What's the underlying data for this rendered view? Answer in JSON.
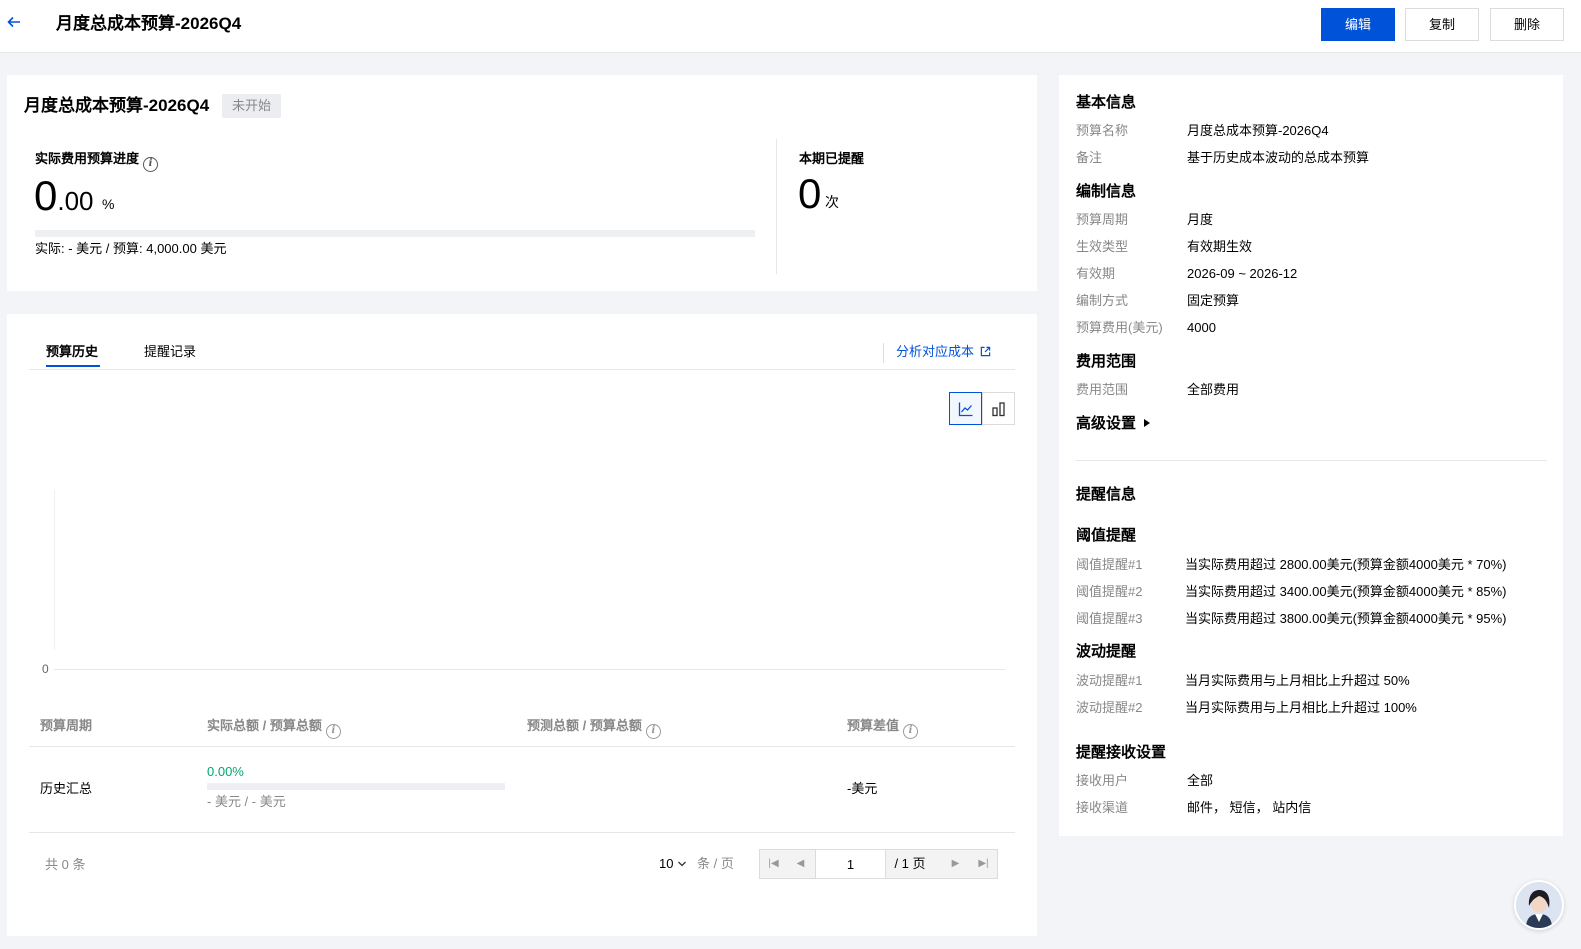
{
  "header": {
    "title": "月度总成本预算-2026Q4",
    "edit_label": "编辑",
    "copy_label": "复制",
    "delete_label": "删除"
  },
  "summary": {
    "title": "月度总成本预算-2026Q4",
    "status": "未开始",
    "progress_label": "实际费用预算进度",
    "progress_int": "0",
    "progress_dec": ".00",
    "progress_unit": "%",
    "progress_fraction": 0,
    "progress_text": "实际: - 美元 / 预算: 4,000.00 美元",
    "alerts_label": "本期已提醒",
    "alerts_count": "0",
    "alerts_unit": "次"
  },
  "history": {
    "tabs": [
      "预算历史",
      "提醒记录"
    ],
    "analyze_link": "分析对应成本",
    "chart_y_tick": "0",
    "columns": [
      "预算周期",
      "实际总额 / 预算总额",
      "预测总额 / 预算总额",
      "预算差值"
    ],
    "row": {
      "period": "历史汇总",
      "pct": "0.00%",
      "actual_budget": "- 美元 / - 美元",
      "diff": "-美元"
    },
    "total": "共 0 条",
    "page_size": "10",
    "page_size_unit": "条 / 页",
    "page_input": "1",
    "page_total": "/ 1 页"
  },
  "info": {
    "basic_title": "基本信息",
    "basic": [
      {
        "k": "预算名称",
        "v": "月度总成本预算-2026Q4"
      },
      {
        "k": "备注",
        "v": "基于历史成本波动的总成本预算"
      }
    ],
    "compile_title": "编制信息",
    "compile": [
      {
        "k": "预算周期",
        "v": "月度"
      },
      {
        "k": "生效类型",
        "v": "有效期生效"
      },
      {
        "k": "有效期",
        "v": "2026-09 ~ 2026-12"
      },
      {
        "k": "编制方式",
        "v": "固定预算"
      },
      {
        "k": "预算费用(美元)",
        "v": "4000"
      }
    ],
    "scope_title": "费用范围",
    "scope": [
      {
        "k": "费用范围",
        "v": "全部费用"
      }
    ],
    "advanced_label": "高级设置",
    "alert_title": "提醒信息",
    "threshold_title": "阈值提醒",
    "thresholds": [
      {
        "k": "阈值提醒#1",
        "v": "当实际费用超过 2800.00美元(预算金额4000美元 * 70%)"
      },
      {
        "k": "阈值提醒#2",
        "v": "当实际费用超过 3400.00美元(预算金额4000美元 * 85%)"
      },
      {
        "k": "阈值提醒#3",
        "v": "当实际费用超过 3800.00美元(预算金额4000美元 * 95%)"
      }
    ],
    "fluct_title": "波动提醒",
    "flucts": [
      {
        "k": "波动提醒#1",
        "v": "当月实际费用与上月相比上升超过 50%"
      },
      {
        "k": "波动提醒#2",
        "v": "当月实际费用与上月相比上升超过 100%"
      }
    ],
    "receive_title": "提醒接收设置",
    "receive": [
      {
        "k": "接收用户",
        "v": "全部"
      },
      {
        "k": "接收渠道",
        "v": "邮件， 短信， 站内信"
      }
    ]
  },
  "colors": {
    "primary": "#0052d9",
    "success": "#00a870"
  }
}
